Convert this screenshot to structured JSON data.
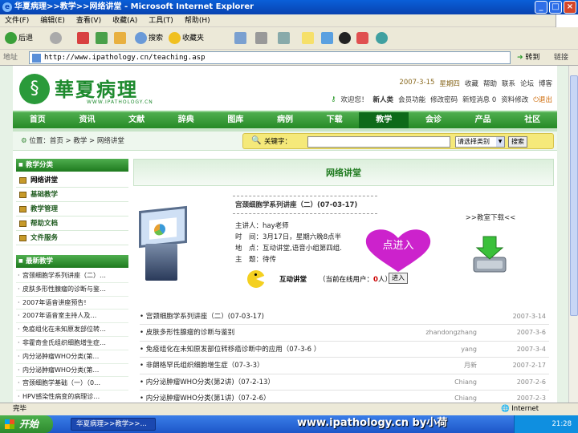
{
  "window": {
    "title": "华夏病理>>教学>>网络讲堂 - Microsoft Internet Explorer",
    "controls": [
      "_",
      "□",
      "×"
    ]
  },
  "menu": [
    "文件(F)",
    "编辑(E)",
    "查看(V)",
    "收藏(A)",
    "工具(T)",
    "帮助(H)"
  ],
  "toolbar": {
    "back": "后退",
    "search": "搜索",
    "favorites": "收藏夹"
  },
  "address": {
    "label": "地址",
    "url": "http://www.ipathology.cn/teaching.asp",
    "go": "转到",
    "links": "链接"
  },
  "site": {
    "logo_text": "華夏病理",
    "logo_sub": "WWW.IPATHOLOGY.CN",
    "top_links": {
      "date": "2007-3-15",
      "weekday": "星期四",
      "items": [
        "收藏",
        "帮助",
        "联系",
        "论坛",
        "博客"
      ]
    },
    "user_links": {
      "welcome": "欢迎您！",
      "username": "新人类",
      "items": [
        "会员功能",
        "修改密码",
        "新短消息",
        "资料修改",
        "退出"
      ],
      "msg_count": "0"
    },
    "nav": [
      "首页",
      "资讯",
      "文献",
      "辞典",
      "图库",
      "病例",
      "下载",
      "教学",
      "会诊",
      "产品",
      "社区"
    ],
    "nav_active": "教学",
    "breadcrumb": "位置：首页 > 教学 > 网络讲堂",
    "search": {
      "label": "关键字：",
      "value": "",
      "select": "请选择类别",
      "button": "搜索"
    }
  },
  "sidebar": {
    "category_title": "教学分类",
    "categories": [
      "网络讲堂",
      "基础教学",
      "教学管理",
      "帮助文档",
      "文件服务"
    ],
    "news_title": "最新教学",
    "news": [
      "宫颈细胞学系列讲座（二）…",
      "皮肤多形性腺瘤的诊断与鉴…",
      "2007年语音讲座预告!",
      "2007年语音室主持人及…",
      "免疫组化在未知原发部位转…",
      "非霍奇金氏组织细胞增生症…",
      "内分泌肿瘤WHO分类(第…",
      "内分泌肿瘤WHO分类(第…",
      "宫颈细胞学基础（一）（0…",
      "HPV感染性病变的病理诊…"
    ]
  },
  "main": {
    "heading": "网络讲堂",
    "lecture": {
      "title": "宫颈细胞学系列讲座（二）(07-03-17)",
      "speaker": "主讲人：hay老师",
      "time": "时　间：3月17日，星期六晚8点半",
      "place": "地　点：互动讲堂,语音小组第四组.",
      "topic": "主　题：待传"
    },
    "click_hint": "点进入",
    "download_label": ">>教室下载<<",
    "interactive": {
      "label": "互动讲堂",
      "online_prefix": "（当前在线用户：",
      "online_count": "0",
      "online_suffix": "人）",
      "enter_button": "进入"
    },
    "rows": [
      {
        "title": "宫颈细胞学系列讲座（二）(07-03-17)",
        "author": "",
        "date": "2007-3-14"
      },
      {
        "title": "皮肤多形性腺瘤的诊断与鉴别",
        "author": "zhandongzhang",
        "date": "2007-3-6"
      },
      {
        "title": "免疫组化在未知原发部位转移癌诊断中的应用（07-3-6 ）",
        "author": "yang",
        "date": "2007-3-4"
      },
      {
        "title": "非朗格罕氏组织细胞增生症（07-3-3）",
        "author": "月新",
        "date": "2007-2-17"
      },
      {
        "title": "内分泌肿瘤WHO分类(第2讲)（07-2-13）",
        "author": "Chiang",
        "date": "2007-2-6"
      },
      {
        "title": "内分泌肿瘤WHO分类(第1讲)（07-2-6）",
        "author": "Chiang",
        "date": "2007-2-3"
      }
    ]
  },
  "status": {
    "left": "完毕",
    "zone": "Internet"
  },
  "taskbar": {
    "start": "开始",
    "task": "华夏病理>>教学>>…",
    "clock": "21:28",
    "watermark": "www.ipathology.cn  by小荷"
  },
  "colors": {
    "brand_green": "#268a26",
    "nav_active": "#0e6a1a",
    "heart": "#cc22cc"
  }
}
